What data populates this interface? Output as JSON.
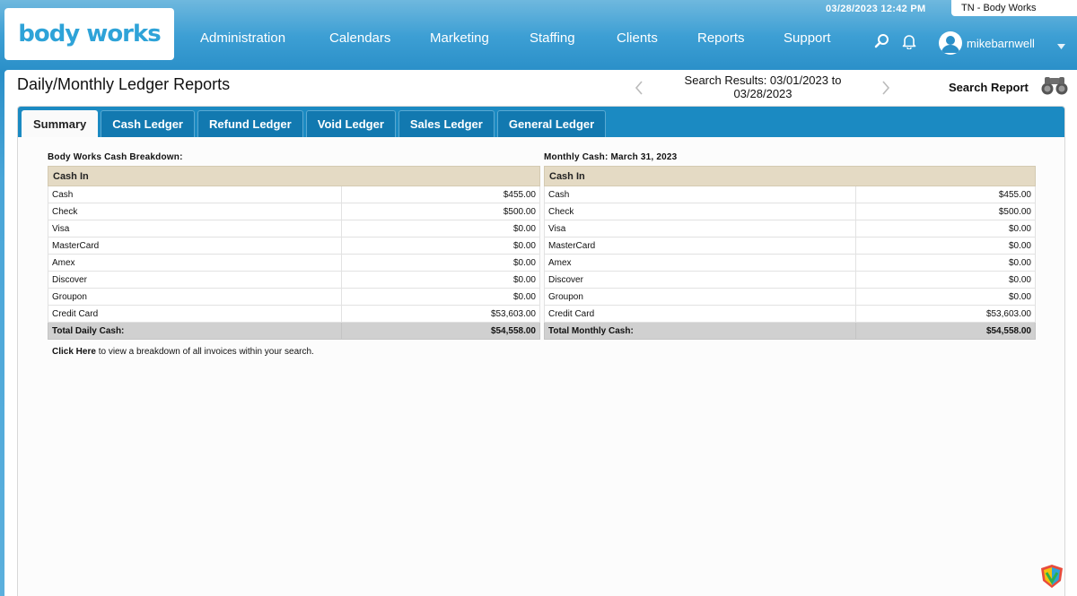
{
  "header": {
    "logo_text": "body works",
    "datetime": "03/28/2023 12:42 PM",
    "location": "TN - Body Works",
    "username": "mikebarnwell",
    "nav": [
      "Administration",
      "Calendars",
      "Marketing",
      "Staffing",
      "Clients",
      "Reports",
      "Support"
    ]
  },
  "page": {
    "title": "Daily/Monthly Ledger Reports",
    "search_results_line1": "Search Results: 03/01/2023 to",
    "search_results_line2": "03/28/2023",
    "search_report_label": "Search Report"
  },
  "tabs": [
    "Summary",
    "Cash Ledger",
    "Refund Ledger",
    "Void Ledger",
    "Sales Ledger",
    "General Ledger"
  ],
  "daily": {
    "title": "Body Works Cash Breakdown:",
    "header": "Cash In",
    "rows": [
      {
        "label": "Cash",
        "amount": "$455.00"
      },
      {
        "label": "Check",
        "amount": "$500.00"
      },
      {
        "label": "Visa",
        "amount": "$0.00"
      },
      {
        "label": "MasterCard",
        "amount": "$0.00"
      },
      {
        "label": "Amex",
        "amount": "$0.00"
      },
      {
        "label": "Discover",
        "amount": "$0.00"
      },
      {
        "label": "Groupon",
        "amount": "$0.00"
      },
      {
        "label": "Credit Card",
        "amount": "$53,603.00"
      }
    ],
    "total_label": "Total Daily Cash:",
    "total_amount": "$54,558.00"
  },
  "monthly": {
    "title": "Monthly Cash: March 31, 2023",
    "header": "Cash In",
    "rows": [
      {
        "label": "Cash",
        "amount": "$455.00"
      },
      {
        "label": "Check",
        "amount": "$500.00"
      },
      {
        "label": "Visa",
        "amount": "$0.00"
      },
      {
        "label": "MasterCard",
        "amount": "$0.00"
      },
      {
        "label": "Amex",
        "amount": "$0.00"
      },
      {
        "label": "Discover",
        "amount": "$0.00"
      },
      {
        "label": "Groupon",
        "amount": "$0.00"
      },
      {
        "label": "Credit Card",
        "amount": "$53,603.00"
      }
    ],
    "total_label": "Total Monthly Cash:",
    "total_amount": "$54,558.00"
  },
  "click_note": {
    "link": "Click Here",
    "text": " to view a breakdown of all invoices within your search."
  },
  "colors": {
    "brand_blue": "#2ea3d8",
    "tab_bar": "#1b8ac2",
    "table_header": "#e4dac4",
    "total_row": "#d0d0d0"
  }
}
